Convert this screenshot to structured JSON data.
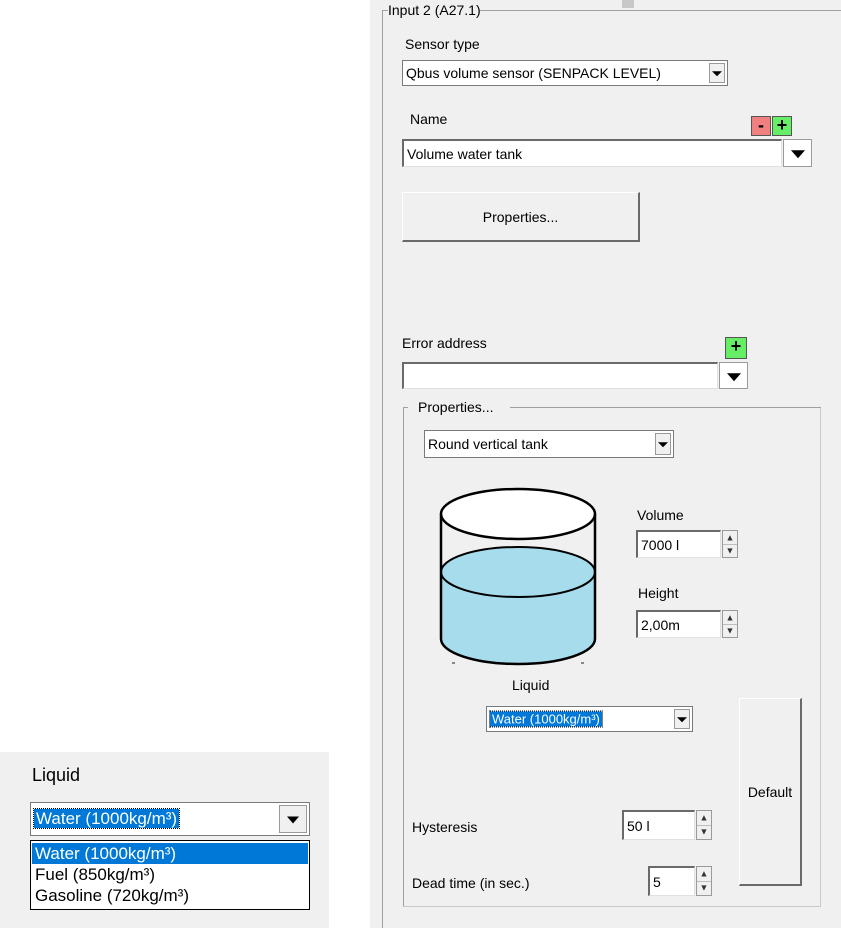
{
  "group_input": {
    "title": "Input 2 (A27.1)",
    "sensor_type_label": "Sensor type",
    "sensor_type_value": "Qbus volume sensor (SENPACK LEVEL)",
    "name_label": "Name",
    "remove_glyph": "-",
    "add_glyph": "+",
    "name_value": "Volume water tank",
    "properties_button": "Properties...",
    "error_address_label": "Error address",
    "error_add_glyph": "+",
    "error_address_value": ""
  },
  "properties_group": {
    "title": "Properties...",
    "tank_type_value": "Round vertical tank",
    "volume_label": "Volume",
    "volume_value": "7000 l",
    "height_label": "Height",
    "height_value": "2,00m",
    "liquid_label": "Liquid",
    "liquid_value": "Water (1000kg/m³)",
    "default_button": "Default",
    "hysteresis_label": "Hysteresis",
    "hysteresis_value": "50 l",
    "dead_time_label": "Dead time (in sec.)",
    "dead_time_value": "5",
    "tank_fill_level": 0.45
  },
  "liquid_dropdown_zoom": {
    "label": "Liquid",
    "selected_value": "Water (1000kg/m³)",
    "options": [
      "Water (1000kg/m³)",
      "Fuel (850kg/m³)",
      "Gasoline (720kg/m³)"
    ],
    "highlighted_index": 0
  },
  "colors": {
    "remove_button": "#f08080",
    "add_button": "#66ee66",
    "liquid_fill": "#a6dcec",
    "selection": "#0078d7"
  },
  "icons": {
    "dropdown": "chevron-down-icon",
    "tank": "cylinder-tank-icon",
    "spin": "spin-arrows-icon"
  }
}
